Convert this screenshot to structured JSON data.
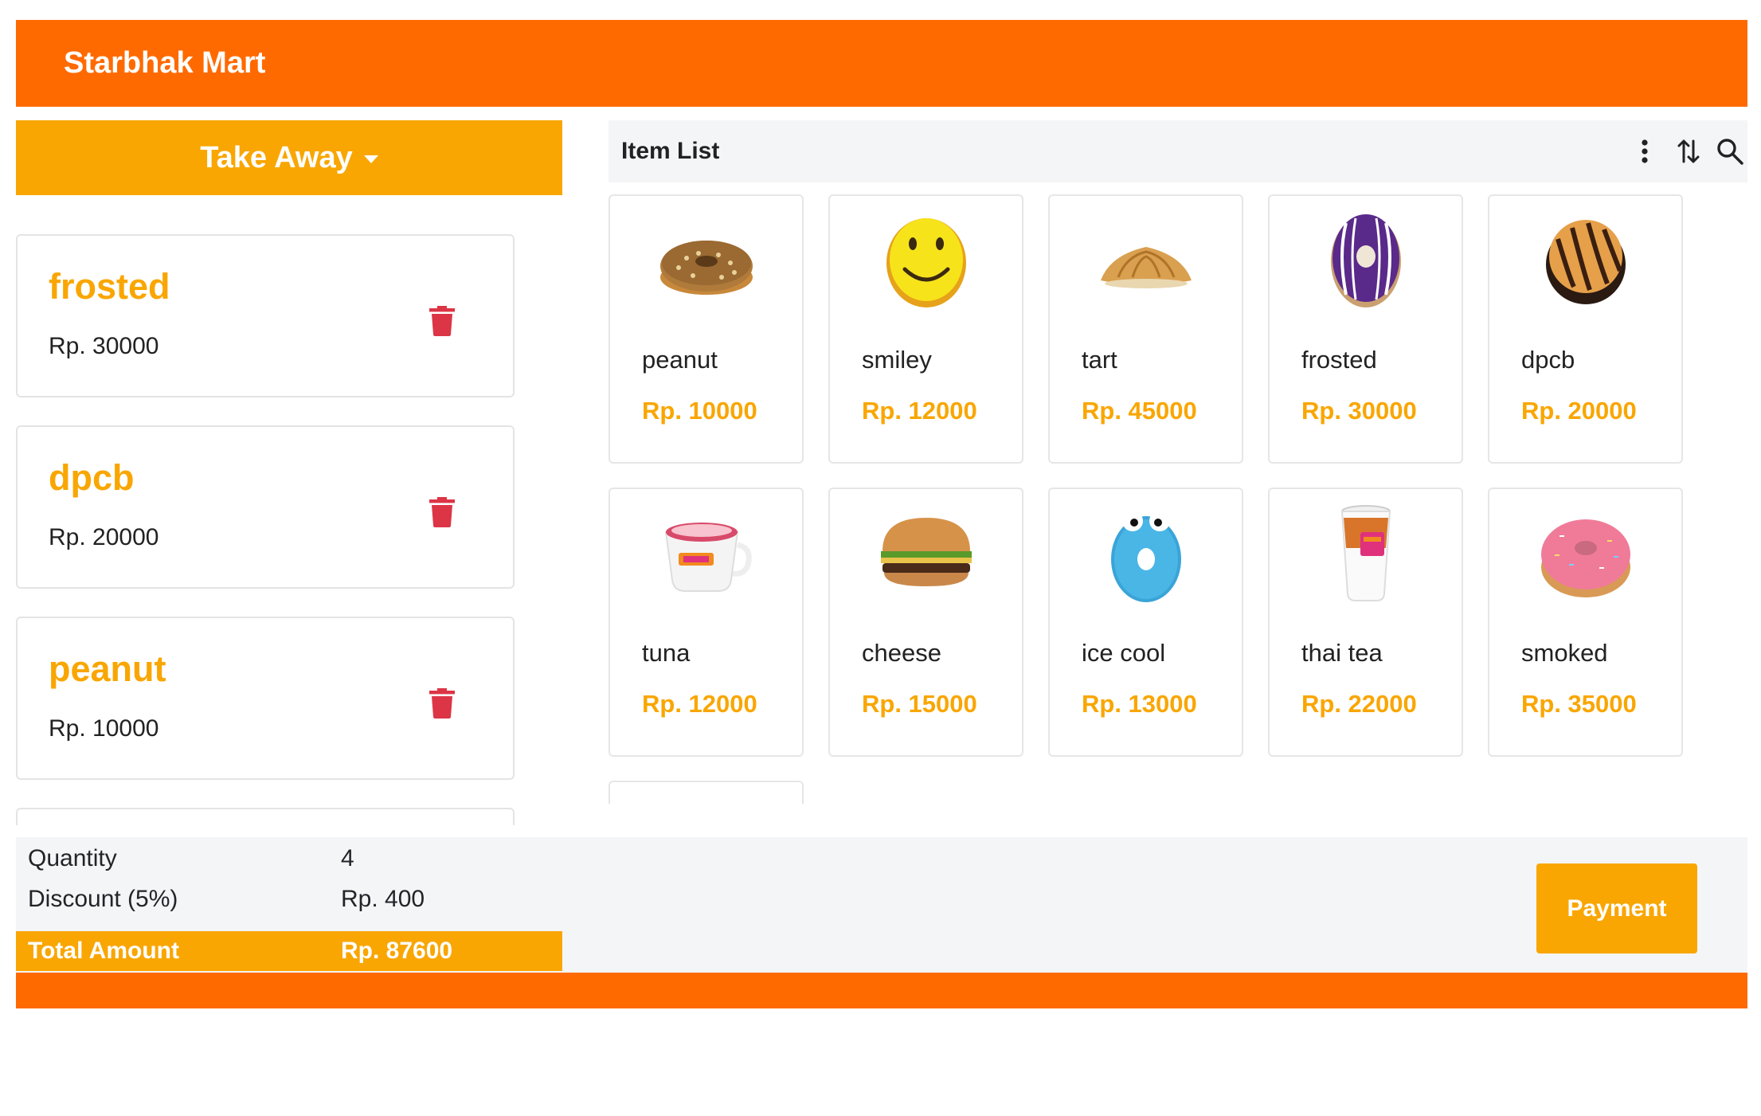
{
  "app": {
    "title": "Starbhak Mart"
  },
  "order_type": {
    "label": "Take Away"
  },
  "cart": {
    "items": [
      {
        "name": "frosted",
        "price": "Rp. 30000"
      },
      {
        "name": "dpcb",
        "price": "Rp. 20000"
      },
      {
        "name": "peanut",
        "price": "Rp. 10000"
      }
    ]
  },
  "item_list": {
    "title": "Item List",
    "items": [
      {
        "name": "peanut",
        "price": "Rp. 10000",
        "image": "peanut-donut"
      },
      {
        "name": "smiley",
        "price": "Rp. 12000",
        "image": "smiley-donut"
      },
      {
        "name": "tart",
        "price": "Rp. 45000",
        "image": "croissant"
      },
      {
        "name": "frosted",
        "price": "Rp. 30000",
        "image": "purple-frosted-donut"
      },
      {
        "name": "dpcb",
        "price": "Rp. 20000",
        "image": "chocolate-drizzle-donut"
      },
      {
        "name": "tuna",
        "price": "Rp. 12000",
        "image": "coffee-cup"
      },
      {
        "name": "cheese",
        "price": "Rp. 15000",
        "image": "burger"
      },
      {
        "name": "ice cool",
        "price": "Rp. 13000",
        "image": "blue-monster-donut"
      },
      {
        "name": "thai tea",
        "price": "Rp. 22000",
        "image": "iced-tea-cup"
      },
      {
        "name": "smoked",
        "price": "Rp. 35000",
        "image": "pink-donut"
      }
    ]
  },
  "summary": {
    "quantity_label": "Quantity",
    "quantity_value": "4",
    "discount_label": "Discount (5%)",
    "discount_value": "Rp. 400",
    "total_label": "Total Amount",
    "total_value": "Rp. 87600",
    "payment_label": "Payment"
  },
  "colors": {
    "brand_orange": "#FF6A00",
    "accent_amber": "#F9A602",
    "delete_red": "#DC3545"
  }
}
